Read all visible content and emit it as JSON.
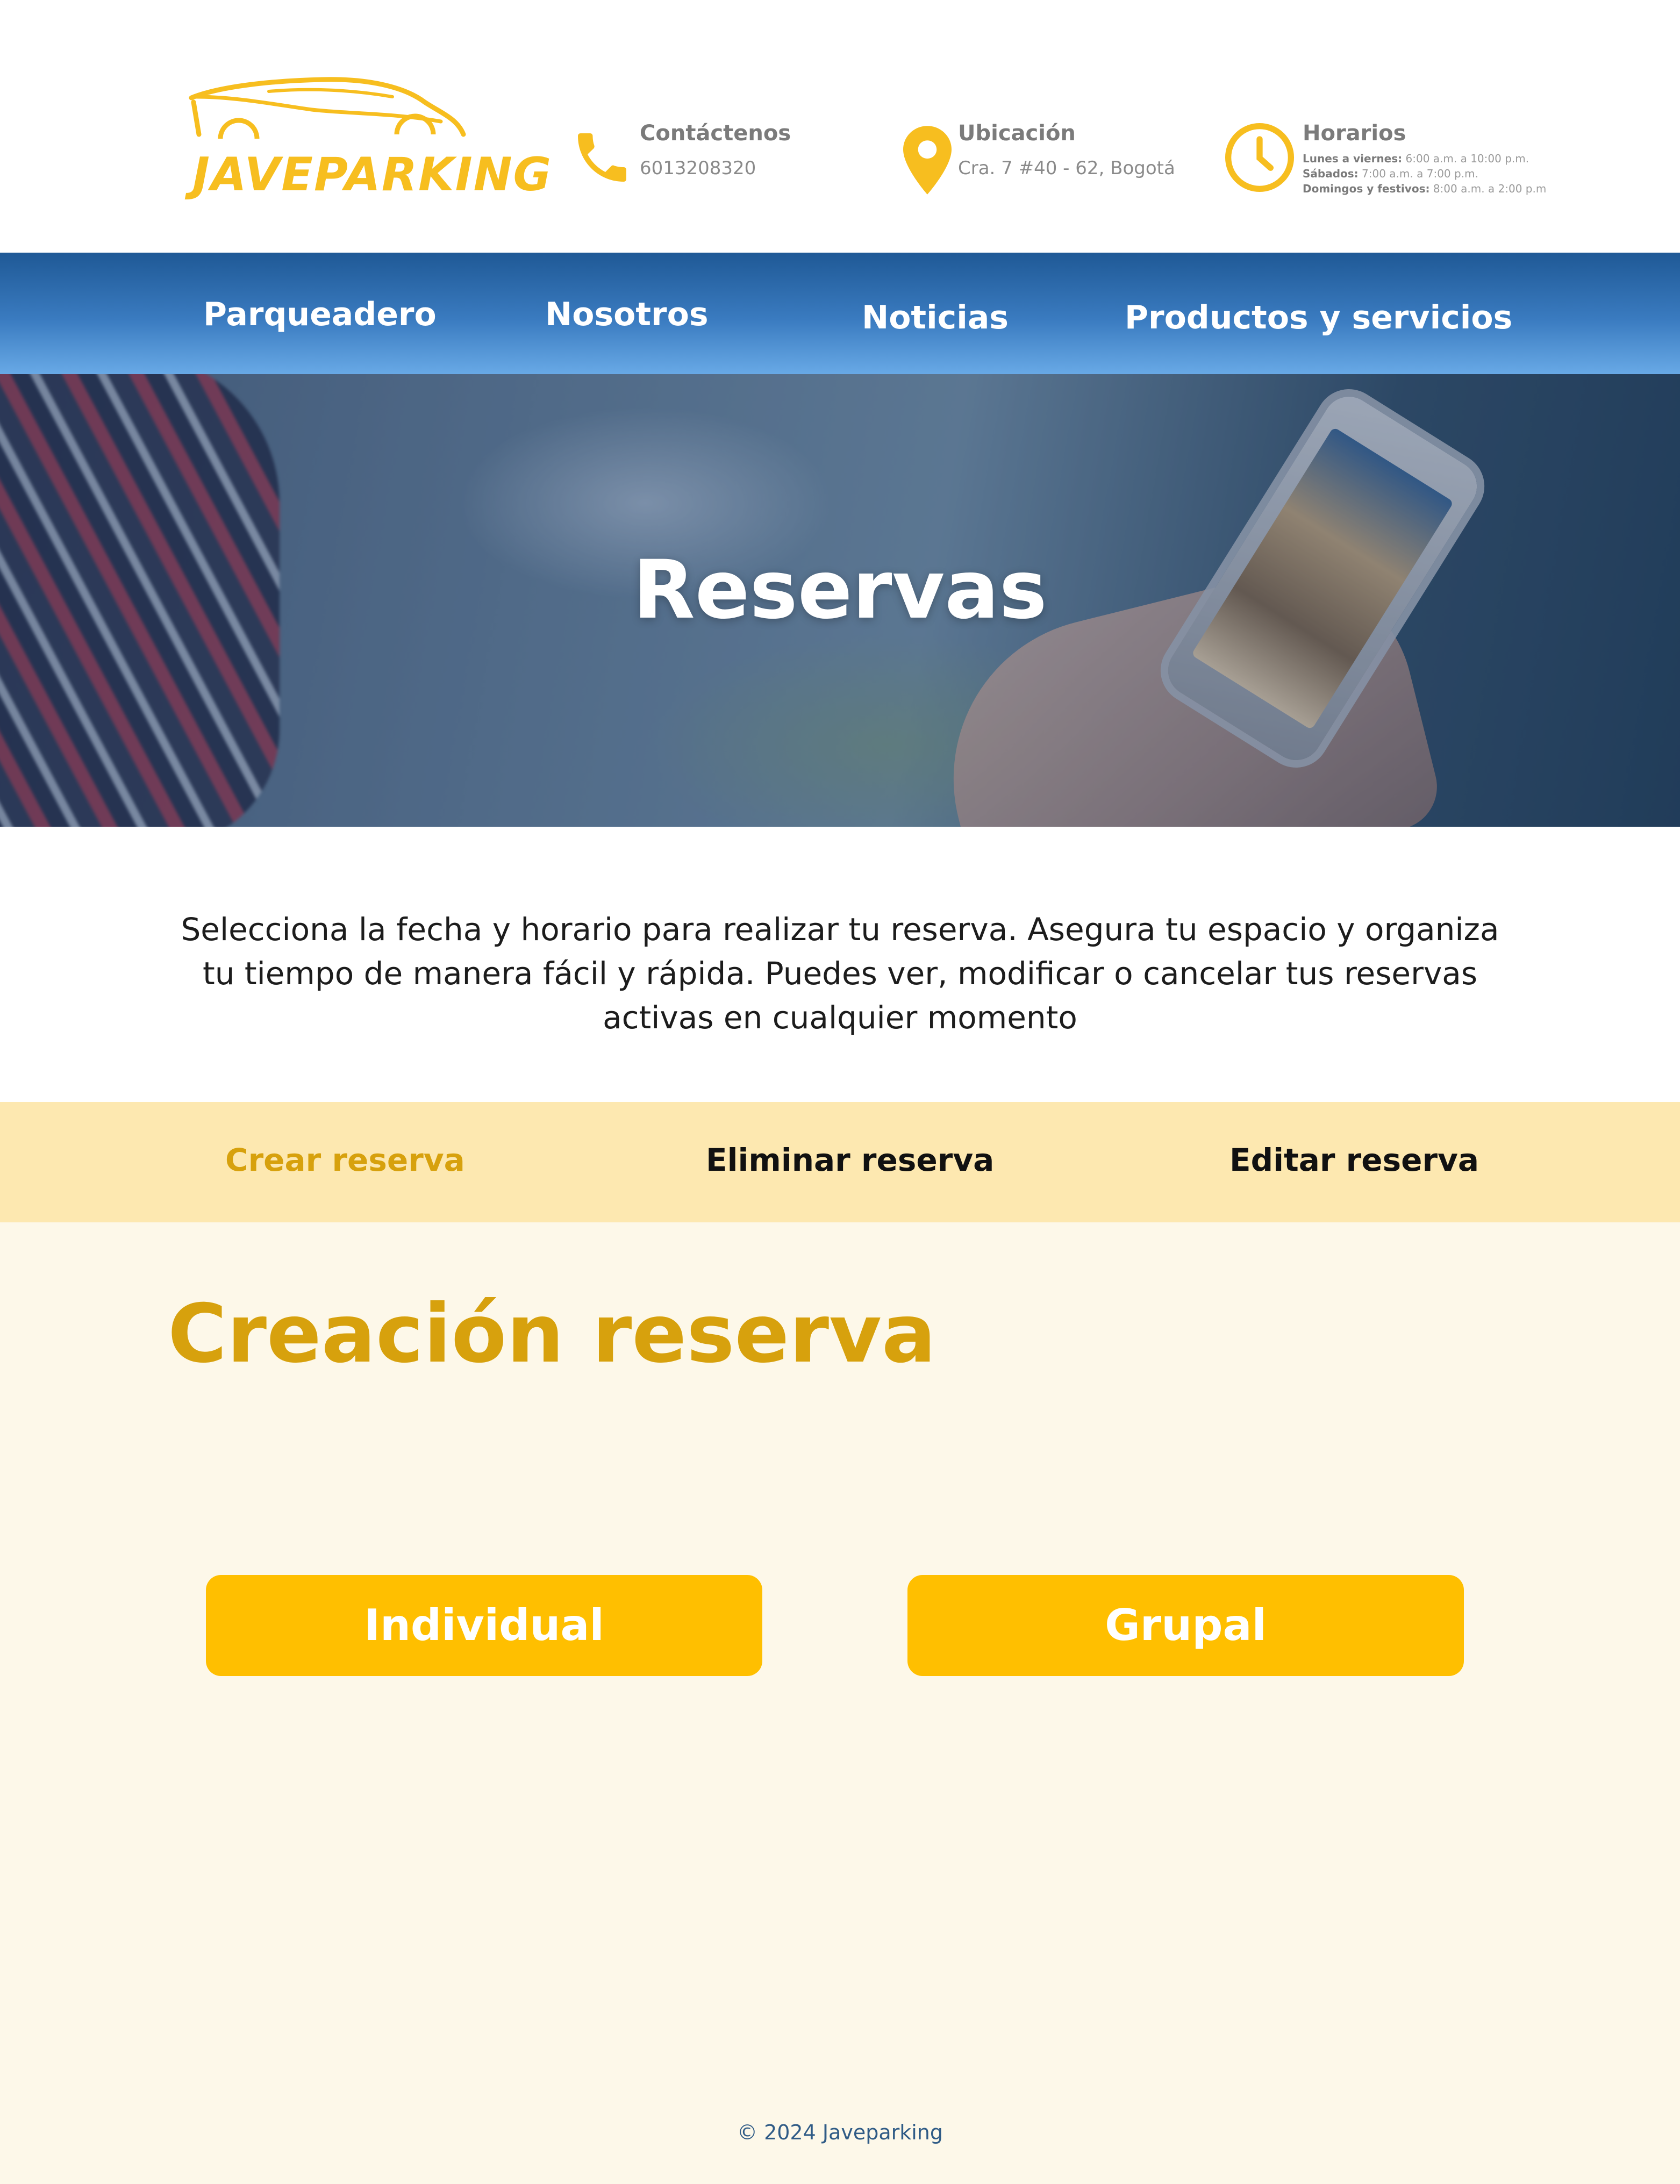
{
  "header": {
    "logo_text": "JAVEPARKING",
    "contact": {
      "title": "Contáctenos",
      "value": "6013208320",
      "icon": "phone-icon"
    },
    "location": {
      "title": "Ubicación",
      "value": "Cra. 7 #40 - 62, Bogotá",
      "icon": "map-pin-icon"
    },
    "hours": {
      "title": "Horarios",
      "icon": "clock-icon",
      "lines": [
        {
          "label": "Lunes a viernes:",
          "value": "6:00 a.m. a 10:00 p.m."
        },
        {
          "label": "Sábados:",
          "value": "7:00 a.m. a 7:00 p.m."
        },
        {
          "label": "Domingos y festivos:",
          "value": "8:00 a.m. a 2:00 p.m"
        }
      ]
    }
  },
  "nav": {
    "items": [
      {
        "label": "Parqueadero"
      },
      {
        "label": "Nosotros"
      },
      {
        "label": "Noticias"
      },
      {
        "label": "Productos y servicios"
      }
    ]
  },
  "hero": {
    "title": "Reservas"
  },
  "intro": {
    "text": "Selecciona la fecha y horario para realizar tu reserva. Asegura tu espacio y organiza tu tiempo de manera fácil y rápida. Puedes ver, modificar o cancelar tus reservas activas en cualquier momento"
  },
  "tabs": [
    {
      "label": "Crear reserva",
      "active": true
    },
    {
      "label": "Eliminar reserva",
      "active": false
    },
    {
      "label": "Editar reserva",
      "active": false
    }
  ],
  "content": {
    "title": "Creación reserva",
    "buttons": {
      "individual": "Individual",
      "grupal": "Grupal"
    }
  },
  "footer": {
    "text": "© 2024 Javeparking"
  },
  "colors": {
    "accent": "#ffbf00",
    "accent_text": "#d7a10d",
    "tabs_bg": "#fde8b0",
    "content_bg": "#fdf8e9",
    "nav_top": "#1f5996",
    "nav_bottom": "#68a9e6"
  }
}
